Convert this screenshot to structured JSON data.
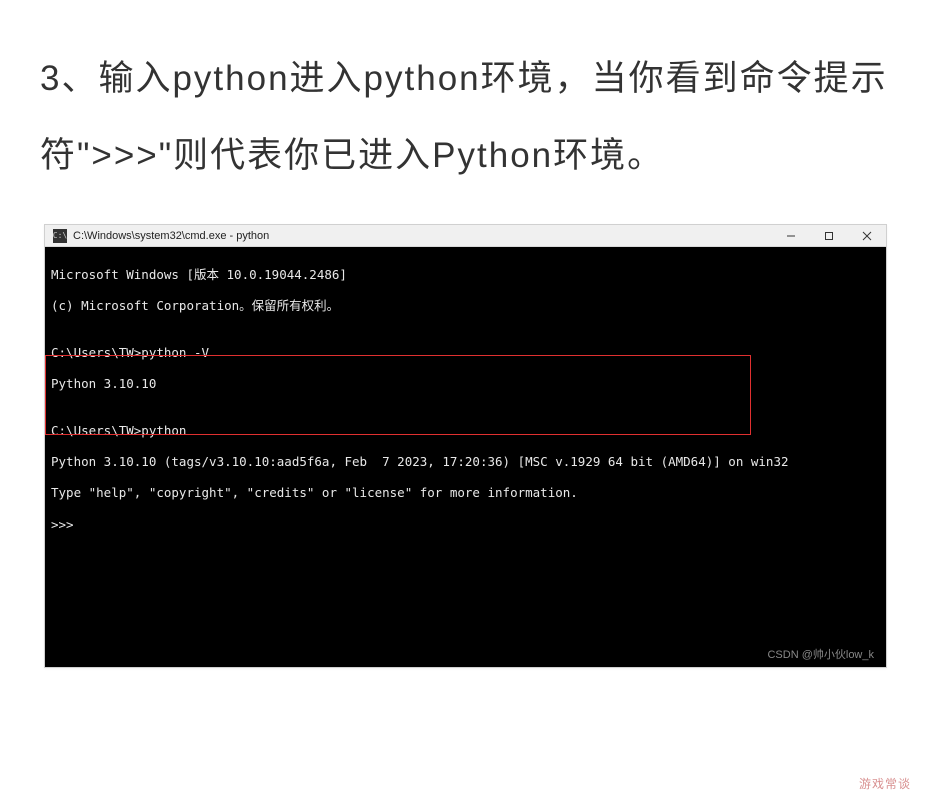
{
  "instruction": "3、输入python进入python环境，当你看到命令提示符\">>>\"则代表你已进入Python环境。",
  "titlebar": {
    "icon_symbol": "C:\\",
    "text": "C:\\Windows\\system32\\cmd.exe - python"
  },
  "window_controls": {
    "minimize": "—",
    "maximize": "☐",
    "close": "✕"
  },
  "terminal": {
    "line1": "Microsoft Windows [版本 10.0.19044.2486]",
    "line2": "(c) Microsoft Corporation。保留所有权利。",
    "blank1": "",
    "line3": "C:\\Users\\TW>python -V",
    "line4": "Python 3.10.10",
    "blank2": "",
    "line5": "C:\\Users\\TW>python",
    "line6": "Python 3.10.10 (tags/v3.10.10:aad5f6a, Feb  7 2023, 17:20:36) [MSC v.1929 64 bit (AMD64)] on win32",
    "line7": "Type \"help\", \"copyright\", \"credits\" or \"license\" for more information.",
    "line8": ">>>"
  },
  "csdn_watermark": "CSDN @帅小伙low_k",
  "footer_watermark": "游戏常谈"
}
